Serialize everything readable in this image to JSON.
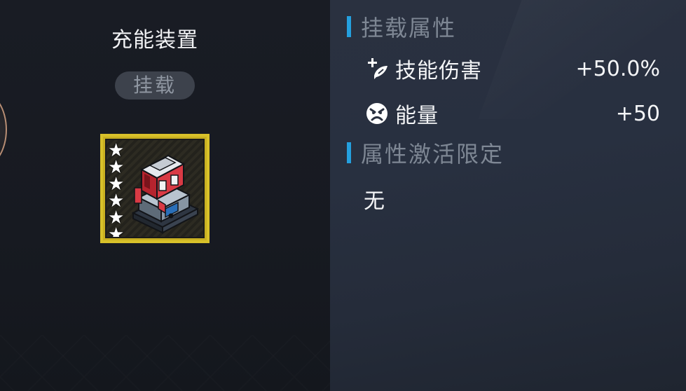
{
  "item": {
    "name": "充能装置",
    "status_badge": "挂载",
    "star_count": 6,
    "icon": "charging-device-icon"
  },
  "attributes_section": {
    "title": "挂载属性",
    "rows": [
      {
        "icon": "skill-damage-icon",
        "label": "技能伤害",
        "value": "+50.0%"
      },
      {
        "icon": "energy-icon",
        "label": "能量",
        "value": "+50"
      }
    ]
  },
  "restriction_section": {
    "title": "属性激活限定",
    "value": "无"
  },
  "colors": {
    "accent_bar": "#24a0df",
    "frame_gold": "#d8c12a"
  }
}
